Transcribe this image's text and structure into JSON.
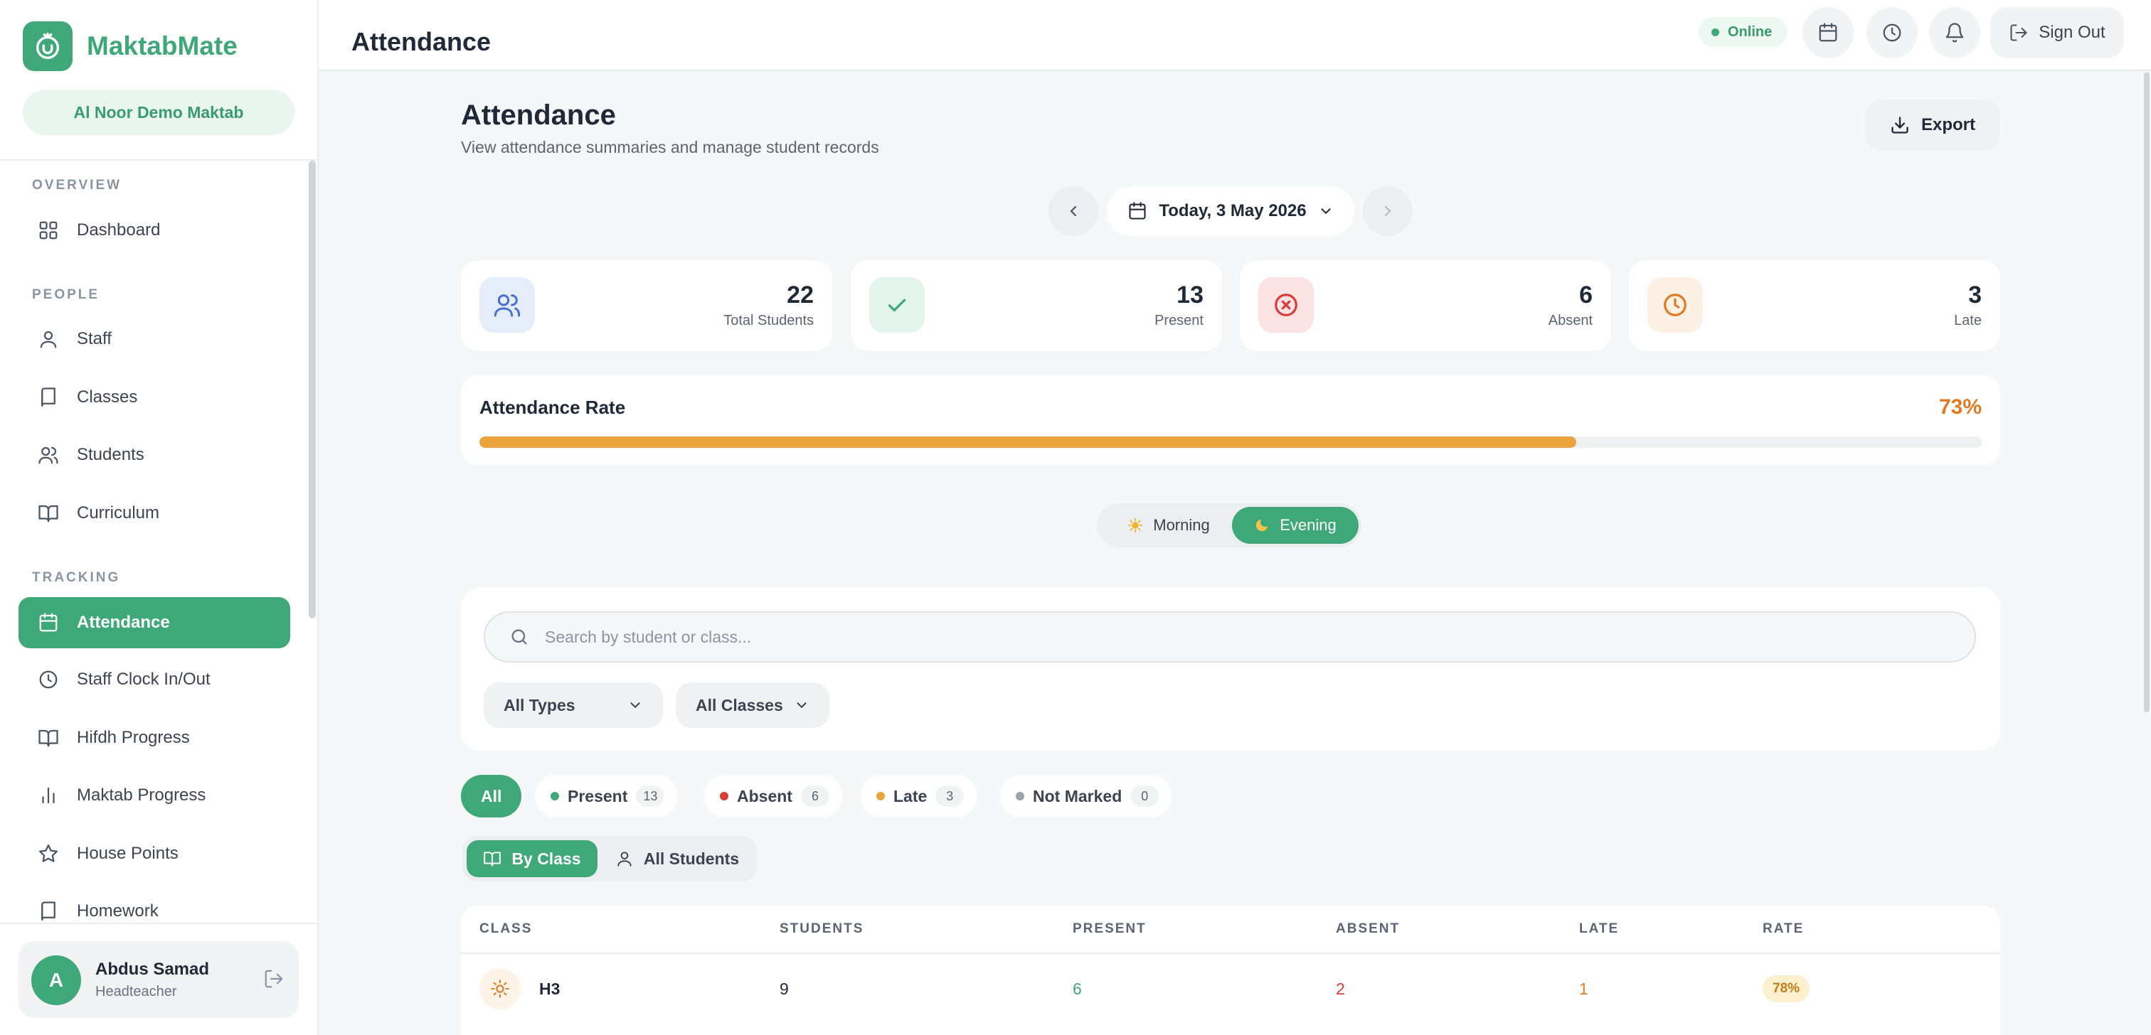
{
  "app": {
    "name": "MaktabMate",
    "org": "Al Noor Demo Maktab"
  },
  "sidebar": {
    "sections": [
      {
        "label": "OVERVIEW"
      },
      {
        "label": "PEOPLE"
      },
      {
        "label": "TRACKING"
      }
    ],
    "items": [
      {
        "label": "Dashboard",
        "icon": "grid-icon"
      },
      {
        "label": "Staff",
        "icon": "user-icon"
      },
      {
        "label": "Classes",
        "icon": "book-icon"
      },
      {
        "label": "Students",
        "icon": "users-icon"
      },
      {
        "label": "Curriculum",
        "icon": "book-open-icon"
      },
      {
        "label": "Attendance",
        "icon": "calendar-icon",
        "active": true
      },
      {
        "label": "Staff Clock In/Out",
        "icon": "clock-icon"
      },
      {
        "label": "Hifdh Progress",
        "icon": "book-open-icon"
      },
      {
        "label": "Maktab Progress",
        "icon": "bar-chart-icon"
      },
      {
        "label": "House Points",
        "icon": "star-icon"
      },
      {
        "label": "Homework",
        "icon": "book-icon"
      }
    ],
    "user": {
      "initial": "A",
      "name": "Abdus Samad",
      "role": "Headteacher"
    }
  },
  "header": {
    "title": "Attendance",
    "status": "Online",
    "sign_out": "Sign Out"
  },
  "main": {
    "title": "Attendance",
    "subtitle": "View attendance summaries and manage student records",
    "export_label": "Export",
    "date_label": "Today, 3 May 2026",
    "stats": [
      {
        "value": "22",
        "label": "Total Students",
        "color": "#4a6fd1"
      },
      {
        "value": "13",
        "label": "Present",
        "color": "#3fa878"
      },
      {
        "value": "6",
        "label": "Absent",
        "color": "#d93a3a"
      },
      {
        "value": "3",
        "label": "Late",
        "color": "#e07b24"
      }
    ],
    "attendance_rate": {
      "label": "Attendance Rate",
      "value": "73%",
      "fraction": 0.73
    },
    "sessions": {
      "morning": "Morning",
      "evening": "Evening",
      "selected": "Evening"
    },
    "search": {
      "placeholder": "Search by student or class..."
    },
    "filters": {
      "type": "All Types",
      "class": "All Classes"
    },
    "status_chips": [
      {
        "label": "All",
        "active": true
      },
      {
        "label": "Present",
        "count": "13",
        "color": "#3fa878"
      },
      {
        "label": "Absent",
        "count": "6",
        "color": "#d93a3a"
      },
      {
        "label": "Late",
        "count": "3",
        "color": "#eba33c"
      },
      {
        "label": "Not Marked",
        "count": "0",
        "color": "#9aa1ab"
      }
    ],
    "view_toggle": {
      "by_class": "By Class",
      "all_students": "All Students",
      "selected": "By Class"
    },
    "table": {
      "columns": [
        "CLASS",
        "STUDENTS",
        "PRESENT",
        "ABSENT",
        "LATE",
        "RATE"
      ],
      "rows": [
        {
          "class": "H3",
          "students": "9",
          "present": "6",
          "absent": "2",
          "late": "1",
          "rate": "78%"
        }
      ]
    }
  }
}
